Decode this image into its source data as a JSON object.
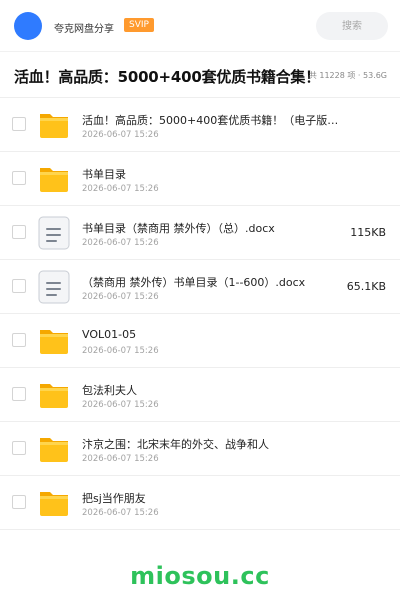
{
  "header": {
    "brand": "夸克网盘分享",
    "badge": "SVIP",
    "search_placeholder": "搜索"
  },
  "title": {
    "text": "活血！高品质：5000+400套优质书籍合集！",
    "summary": "共 11228 项 · 53.6G"
  },
  "files": [
    {
      "type": "folder",
      "name": "活血！高品质：5000+400套优质书籍！（电子版…",
      "date": "2026-06-07 15:26",
      "size": ""
    },
    {
      "type": "folder",
      "name": "书单目录",
      "date": "2026-06-07 15:26",
      "size": ""
    },
    {
      "type": "doc",
      "name": "书单目录（禁商用 禁外传）（总）.docx",
      "date": "2026-06-07 15:26",
      "size": "115KB"
    },
    {
      "type": "doc",
      "name": "（禁商用 禁外传）书单目录（1--600）.docx",
      "date": "2026-06-07 15:26",
      "size": "65.1KB"
    },
    {
      "type": "folder",
      "name": "VOL01-05",
      "date": "2026-06-07 15:26",
      "size": ""
    },
    {
      "type": "folder",
      "name": "包法利夫人",
      "date": "2026-06-07 15:26",
      "size": ""
    },
    {
      "type": "folder",
      "name": "汴京之围：北宋末年的外交、战争和人",
      "date": "2026-06-07 15:26",
      "size": ""
    },
    {
      "type": "folder",
      "name": "把sj当作朋友",
      "date": "2026-06-07 15:26",
      "size": ""
    }
  ],
  "footer": {
    "brand": "miosou.cc"
  },
  "colors": {
    "accent_blue": "#2f7bff",
    "svip_orange": "#ff9a2e",
    "folder_yellow": "#ffc21a",
    "watermark_green": "#2ec25b"
  }
}
